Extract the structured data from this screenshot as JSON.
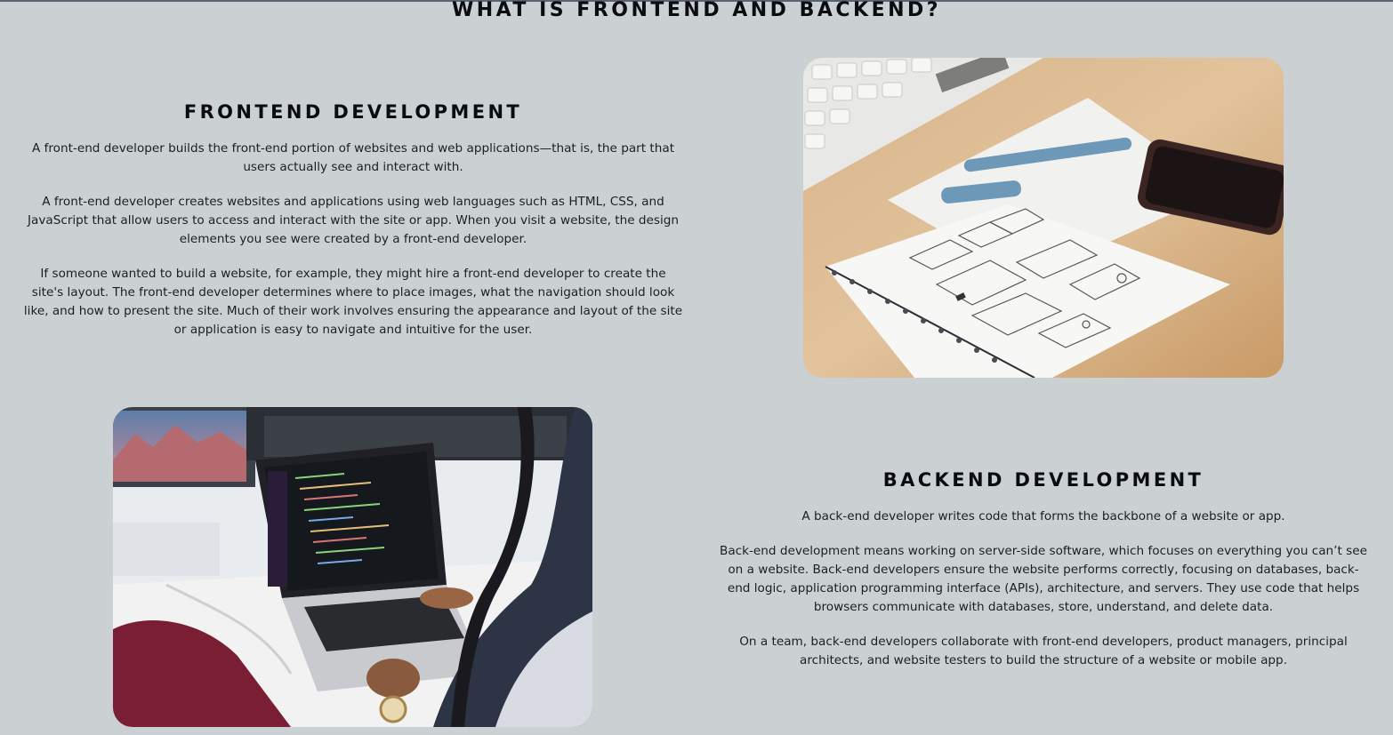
{
  "page": {
    "title": "WHAT IS FRONTEND AND BACKEND?"
  },
  "frontend": {
    "title": "FRONTEND DEVELOPMENT",
    "paragraphs": [
      "A front-end developer builds the front-end portion of websites and web applications—that is, the part that users actually see and interact with.",
      "A front-end developer creates websites and applications using web languages such as HTML, CSS, and JavaScript that allow users to access and interact with the site or app. When you visit a website, the design elements you see were created by a front-end developer.",
      "If someone wanted to build a website, for example, they might hire a front-end developer to create the site's layout. The front-end developer determines where to place images, what the navigation should look like, and how to present the site. Much of their work involves ensuring the appearance and layout of the site or application is easy to navigate and intuitive for the user."
    ]
  },
  "backend": {
    "title": "BACKEND DEVELOPMENT",
    "paragraphs": [
      "A back-end developer writes code that forms the backbone of a website or app.",
      "Back-end development means working on server-side software, which focuses on everything you can’t see on a website. Back-end developers ensure the website performs correctly, focusing on databases, back-end logic, application programming interface (APIs), architecture, and servers. They use code that helps browsers communicate with databases, store, understand, and delete data.",
      "On a team, back-end developers collaborate with front-end developers, product managers, principal architects, and website testers to build the structure of a website or mobile app."
    ]
  },
  "images": {
    "frontend_photo": "photo of wireframe sketch notebook, pens, keyboard and phone on desk",
    "backend_photo": "photo of person coding on laptop at desk with monitor"
  },
  "colors": {
    "background": "#cbd1d3",
    "heading": "#0b0b12",
    "body_text": "#1e1e1e"
  }
}
